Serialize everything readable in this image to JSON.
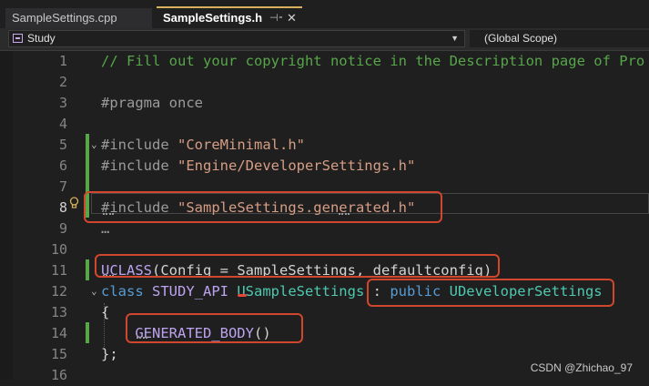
{
  "tabs": [
    {
      "label": "SampleSettings.cpp",
      "active": false
    },
    {
      "label": "SampleSettings.h",
      "active": true,
      "pin_icon": "pin-icon",
      "close_icon": "close-icon"
    }
  ],
  "navbar": {
    "project": "Study",
    "project_icon": "project-icon",
    "scope": "(Global Scope)"
  },
  "editor": {
    "current_line": 8,
    "lines": [
      {
        "n": "1",
        "tokens": [
          {
            "t": "// Fill out your copyright notice in the Description page of Pro",
            "c": "comment"
          }
        ]
      },
      {
        "n": "2",
        "tokens": []
      },
      {
        "n": "3",
        "tokens": [
          {
            "t": "#pragma once",
            "c": "preproc"
          }
        ]
      },
      {
        "n": "4",
        "tokens": []
      },
      {
        "n": "5",
        "tokens": [
          {
            "t": "#include ",
            "c": "preproc"
          },
          {
            "t": "\"CoreMinimal.h\"",
            "c": "string"
          }
        ]
      },
      {
        "n": "6",
        "tokens": [
          {
            "t": "#include ",
            "c": "preproc"
          },
          {
            "t": "\"Engine/DeveloperSettings.h\"",
            "c": "string"
          }
        ]
      },
      {
        "n": "7",
        "tokens": []
      },
      {
        "n": "8",
        "tokens": [
          {
            "t": "#include ",
            "c": "preproc"
          },
          {
            "t": "\"SampleSettings.generated.h\"",
            "c": "string"
          }
        ]
      },
      {
        "n": "9",
        "tokens": [
          {
            "t": "…",
            "c": "ellipsis"
          }
        ]
      },
      {
        "n": "10",
        "tokens": []
      },
      {
        "n": "11",
        "tokens": [
          {
            "t": "UCLASS",
            "c": "macro"
          },
          {
            "t": "(Config = SampleSettings, defaultconfig)",
            "c": "plain"
          }
        ]
      },
      {
        "n": "12",
        "tokens": [
          {
            "t": "class ",
            "c": "kw"
          },
          {
            "t": "STUDY_API ",
            "c": "macro"
          },
          {
            "t": "USampleSettings",
            "c": "type"
          },
          {
            "t": " : ",
            "c": "plain"
          },
          {
            "t": "public ",
            "c": "kw"
          },
          {
            "t": "UDeveloperSettings",
            "c": "type"
          }
        ]
      },
      {
        "n": "13",
        "tokens": [
          {
            "t": "{",
            "c": "plain"
          }
        ]
      },
      {
        "n": "14",
        "tokens": [
          {
            "t": "    ",
            "c": "plain"
          },
          {
            "t": "GENERATED_BODY",
            "c": "macro"
          },
          {
            "t": "()",
            "c": "plain"
          }
        ]
      },
      {
        "n": "15",
        "tokens": [
          {
            "t": "};",
            "c": "plain"
          }
        ]
      },
      {
        "n": "16",
        "tokens": []
      }
    ],
    "lightbulb_icon": "lightbulb-icon",
    "fold_icon": "collapse-chevron-icon"
  },
  "watermark": "CSDN @Zhichao_97",
  "colors": {
    "background": "#1f1f1f",
    "comment": "#57a64a",
    "string": "#d69d85",
    "macro": "#bea3f0",
    "keyword": "#569cd6",
    "type": "#4ec9b0",
    "annotation_box": "#d0472d",
    "change_bar": "#57a64a"
  }
}
